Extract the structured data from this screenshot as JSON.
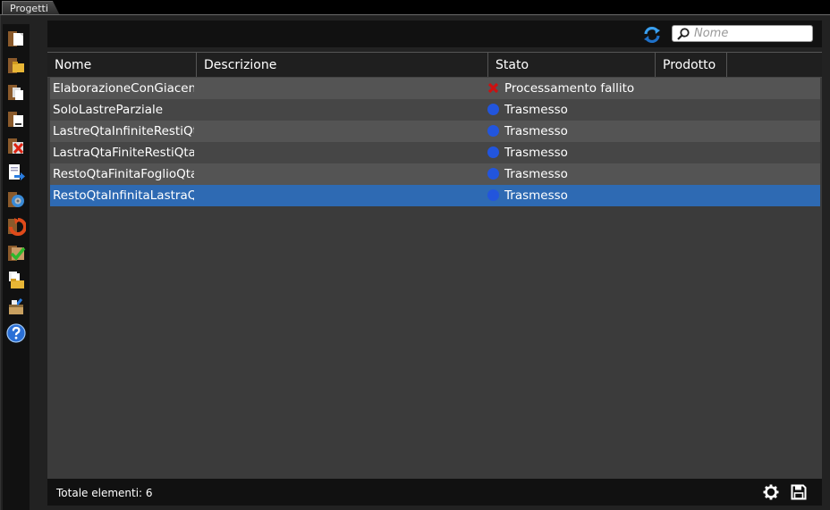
{
  "tab": {
    "title": "Progetti"
  },
  "sidebar": {
    "items": [
      {
        "name": "new-project-icon"
      },
      {
        "name": "open-folder-icon"
      },
      {
        "name": "copy-project-icon"
      },
      {
        "name": "project-list-icon"
      },
      {
        "name": "delete-project-icon"
      },
      {
        "name": "export-project-icon"
      },
      {
        "name": "process-gear-icon"
      },
      {
        "name": "reset-icon"
      },
      {
        "name": "approve-icon"
      },
      {
        "name": "import-files-icon"
      },
      {
        "name": "archive-icon"
      },
      {
        "name": "help-icon"
      }
    ]
  },
  "toolbar": {
    "search_placeholder": "Nome",
    "search_value": ""
  },
  "table": {
    "columns": [
      "Nome",
      "Descrizione",
      "Stato",
      "Prodotto"
    ],
    "rows": [
      {
        "nome": "ElaborazioneConGiacenze",
        "descrizione": "",
        "stato": "Processamento fallito",
        "stato_icon": "error-x-icon",
        "prodotto": ""
      },
      {
        "nome": "SoloLastreParziale",
        "descrizione": "",
        "stato": "Trasmesso",
        "stato_icon": "blue-dot-icon",
        "prodotto": ""
      },
      {
        "nome": "LastreQtaInfiniteRestiQtaI",
        "descrizione": "",
        "stato": "Trasmesso",
        "stato_icon": "blue-dot-icon",
        "prodotto": ""
      },
      {
        "nome": "LastraQtaFiniteRestiQtaInf",
        "descrizione": "",
        "stato": "Trasmesso",
        "stato_icon": "blue-dot-icon",
        "prodotto": ""
      },
      {
        "nome": "RestoQtaFinitaFoglioQtaF",
        "descrizione": "",
        "stato": "Trasmesso",
        "stato_icon": "blue-dot-icon",
        "prodotto": ""
      },
      {
        "nome": "RestoQtaInfinitaLastraQta",
        "descrizione": "",
        "stato": "Trasmesso",
        "stato_icon": "blue-dot-icon",
        "prodotto": ""
      }
    ],
    "selected_index": 5
  },
  "footer": {
    "count_label": "Totale elementi: 6"
  },
  "colors": {
    "selection": "#2e6ab3",
    "status_ok": "#2255dd",
    "status_error": "#cc1111"
  }
}
